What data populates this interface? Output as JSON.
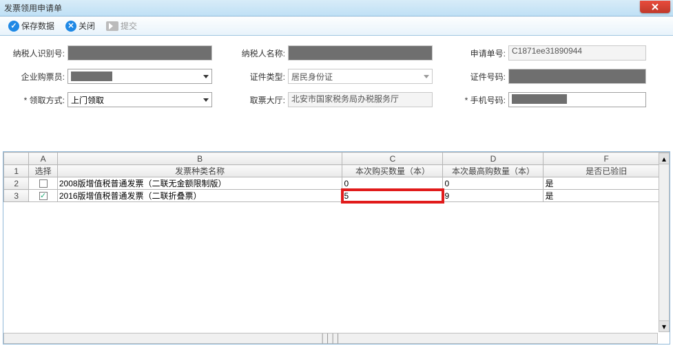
{
  "window": {
    "title": "发票领用申请单"
  },
  "toolbar": {
    "save": "保存数据",
    "close": "关闭",
    "submit": "提交"
  },
  "form": {
    "taxpayer_id_label": "纳税人识别号:",
    "taxpayer_id_value": "",
    "taxpayer_name_label": "纳税人名称:",
    "taxpayer_name_value": "",
    "apply_no_label": "申请单号:",
    "apply_no_value": "C1871ee31890944",
    "buyer_label": "企业购票员:",
    "buyer_value": "",
    "cert_type_label": "证件类型:",
    "cert_type_value": "居民身份证",
    "cert_no_label": "证件号码:",
    "cert_no_value": "",
    "receive_mode_label": "领取方式:",
    "receive_mode_value": "上门领取",
    "pickup_hall_label": "取票大厅:",
    "pickup_hall_value": "北安市国家税务局办税服务厅",
    "phone_label": "手机号码:",
    "phone_value": ""
  },
  "grid": {
    "col_letters": [
      "",
      "A",
      "B",
      "C",
      "D",
      "F"
    ],
    "headers": {
      "select": "选择",
      "invoice_name": "发票种类名称",
      "buy_qty": "本次购买数量（本）",
      "max_qty": "本次最高购数量（本）",
      "verified": "是否已验旧"
    },
    "rows": [
      {
        "idx": "2",
        "checked": false,
        "name": "2008版增值税普通发票（二联无金额限制版）",
        "buy_qty": "0",
        "max_qty": "0",
        "verified": "是",
        "highlight": false
      },
      {
        "idx": "3",
        "checked": true,
        "name": "2016版增值税普通发票（二联折叠票）",
        "buy_qty": "5",
        "max_qty": "9",
        "verified": "是",
        "highlight": true
      }
    ]
  }
}
